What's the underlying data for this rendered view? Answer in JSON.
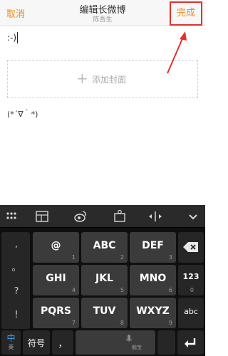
{
  "header": {
    "cancel_label": "取消",
    "title": "编辑长微博",
    "subtitle": "陈吾生",
    "done_label": "完成"
  },
  "editor": {
    "emoticon_text": ":-)",
    "add_cover_label": "添加封面",
    "kaomoji_text": "(*´∇｀*)"
  },
  "keyboard": {
    "punct_column": [
      ",",
      "。",
      "?",
      "!"
    ],
    "rows": [
      [
        {
          "label": "@",
          "digit": "1"
        },
        {
          "label": "ABC",
          "digit": "2"
        },
        {
          "label": "DEF",
          "digit": "3"
        }
      ],
      [
        {
          "label": "GHI",
          "digit": "4"
        },
        {
          "label": "JKL",
          "digit": "5"
        },
        {
          "label": "MNO",
          "digit": "6"
        }
      ],
      [
        {
          "label": "PQRS",
          "digit": "7"
        },
        {
          "label": "TUV",
          "digit": "8"
        },
        {
          "label": "WXYZ",
          "digit": "9"
        }
      ]
    ],
    "numeric_key": {
      "label": "123",
      "digit": "0"
    },
    "abc_key": "abc",
    "bottom": {
      "lang_label": "中",
      "lang_sub": "英",
      "symbol_label": "符号",
      "comma_label": "，",
      "space_hint": "触宝"
    }
  },
  "colors": {
    "accent": "#f08a1c",
    "annotation": "#e0322b"
  },
  "icons": [
    "backspace-icon",
    "enter-icon",
    "microphone-icon",
    "weibo-icon",
    "cursor-move-icon",
    "collapse-icon",
    "emoji-keyboard-icon",
    "clipboard-icon"
  ]
}
